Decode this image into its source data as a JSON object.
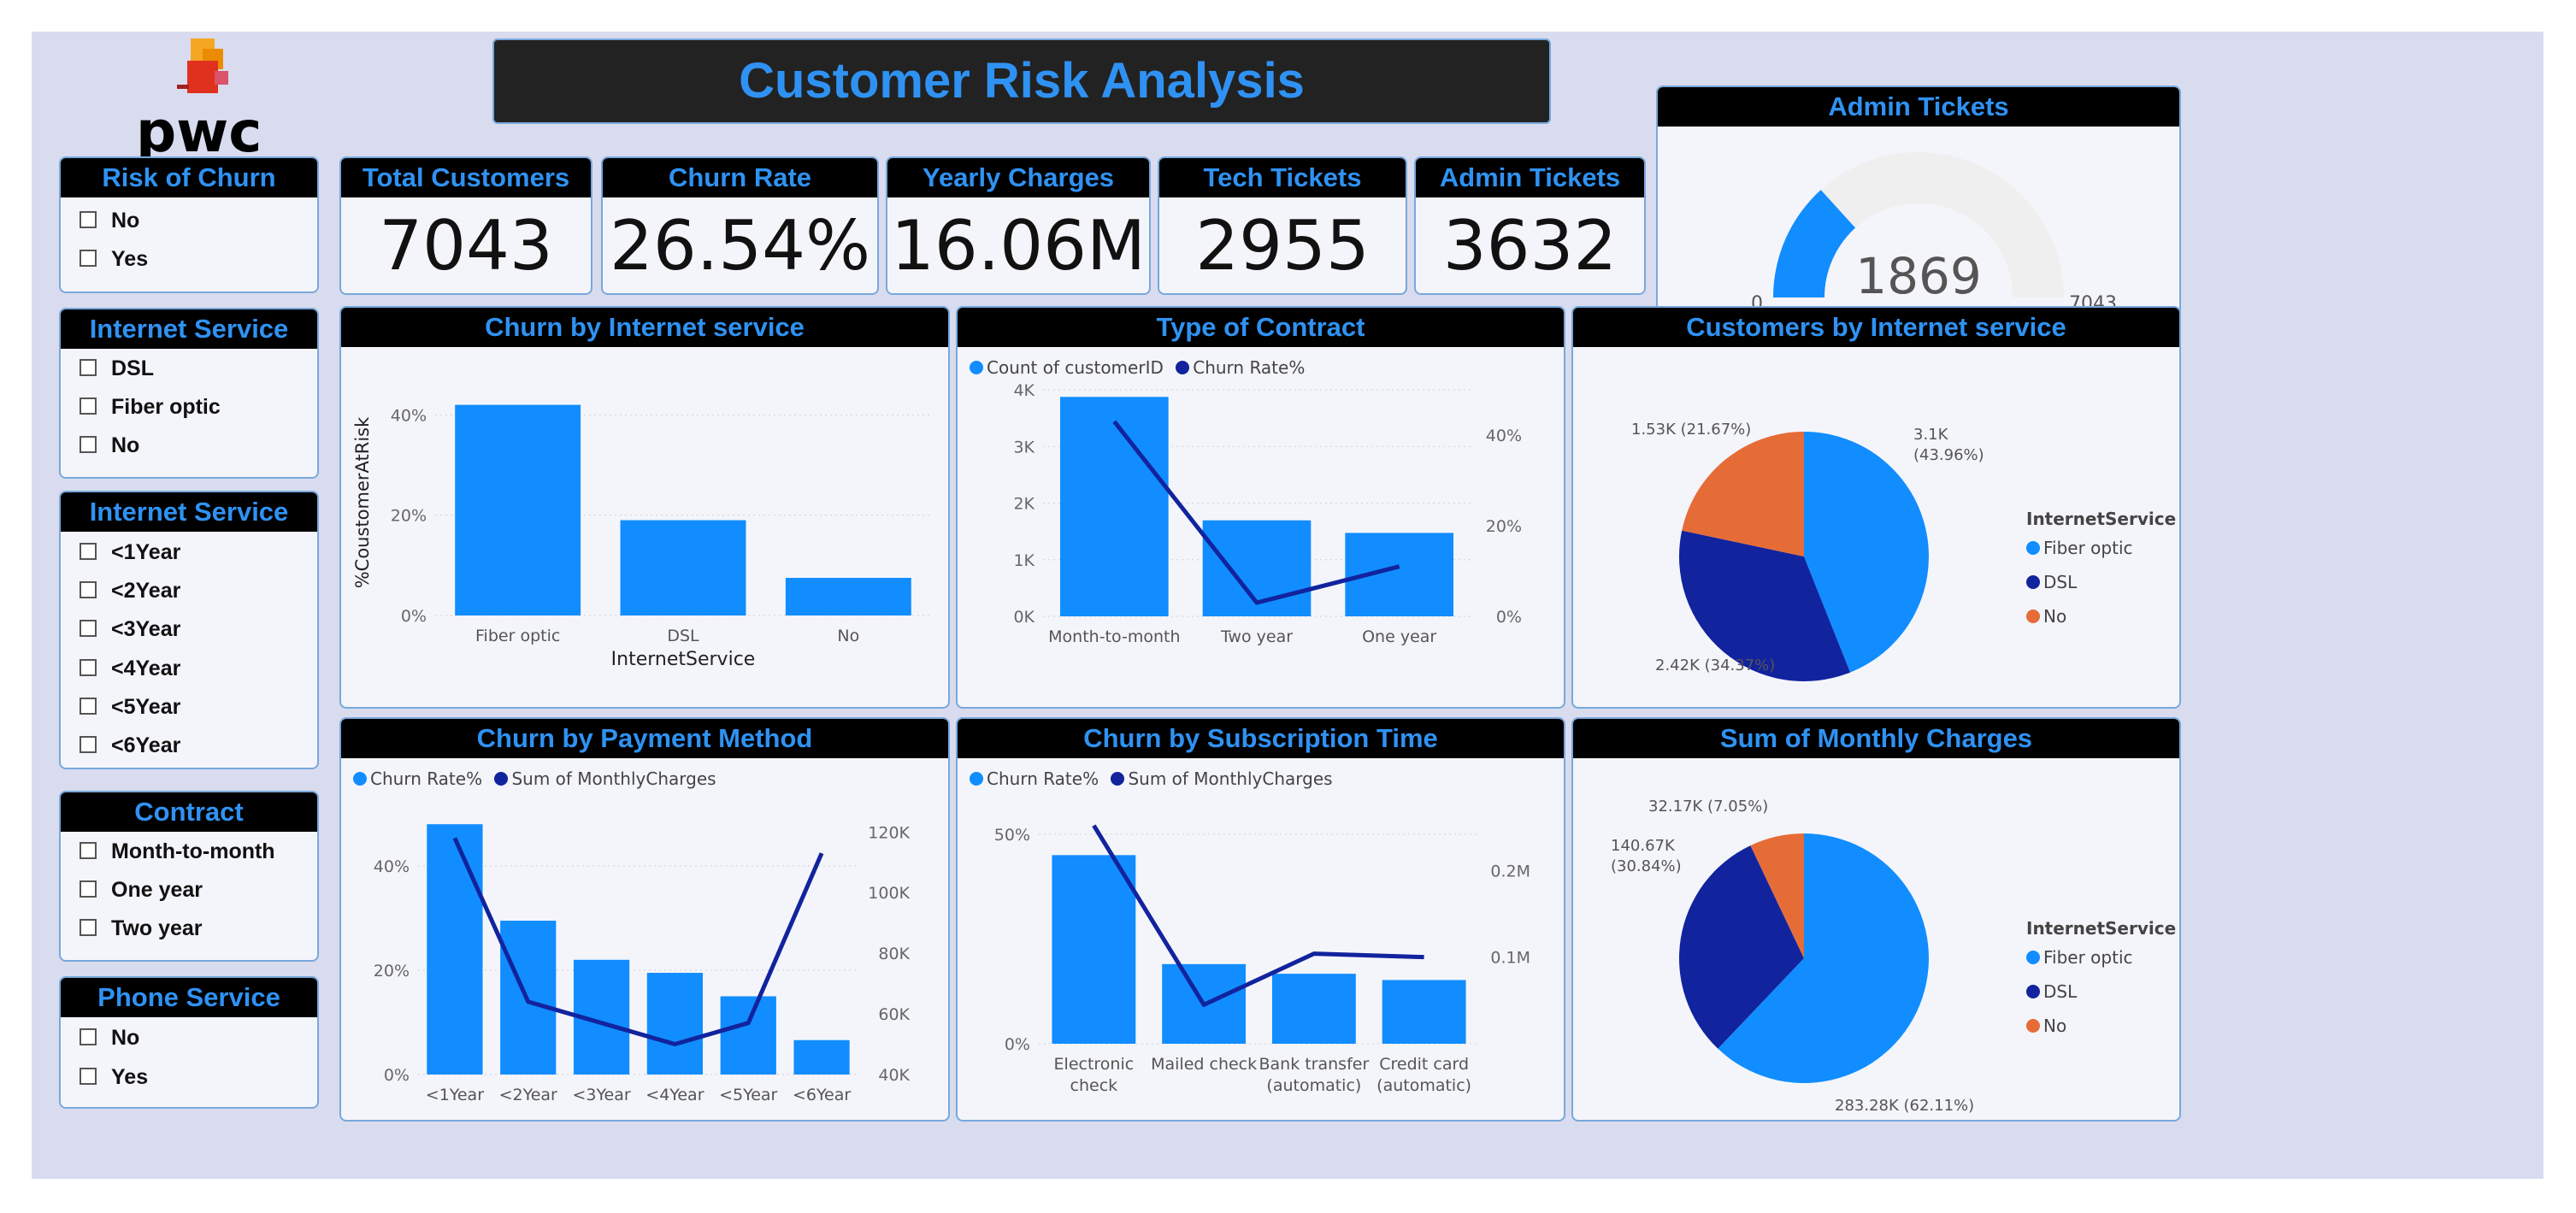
{
  "title": "Customer Risk Analysis",
  "logo": {
    "text": "pwc"
  },
  "colors": {
    "bar": "#118dff",
    "line": "#12239e",
    "orange": "#e66c37",
    "header_bg": "#000000",
    "header_text": "#2f92f3",
    "gauge_track": "#efefef"
  },
  "slicers": [
    {
      "title": "Risk of Churn",
      "items": [
        "No",
        "Yes"
      ]
    },
    {
      "title": "Internet Service",
      "items": [
        "DSL",
        "Fiber optic",
        "No"
      ]
    },
    {
      "title": "Internet Service",
      "items": [
        "<1Year",
        "<2Year",
        "<3Year",
        "<4Year",
        "<5Year",
        "<6Year"
      ]
    },
    {
      "title": "Contract",
      "items": [
        "Month-to-month",
        "One year",
        "Two year"
      ]
    },
    {
      "title": "Phone Service",
      "items": [
        "No",
        "Yes"
      ]
    }
  ],
  "kpis": [
    {
      "label": "Total Customers",
      "value": "7043"
    },
    {
      "label": "Churn Rate",
      "value": "26.54%"
    },
    {
      "label": "Yearly Charges",
      "value": "16.06M"
    },
    {
      "label": "Tech Tickets",
      "value": "2955"
    },
    {
      "label": "Admin Tickets",
      "value": "3632"
    }
  ],
  "gauge": {
    "title": "Admin Tickets",
    "value": 1869,
    "value_label": "1869",
    "min": 0,
    "min_label": "0",
    "max": 7043,
    "max_label": "7043"
  },
  "chart_data": [
    {
      "id": "churn_by_internet",
      "type": "bar",
      "title": "Churn by Internet service",
      "xlabel": "InternetService",
      "ylabel": "%CoustomerAtRisk",
      "categories": [
        "Fiber optic",
        "DSL",
        "No"
      ],
      "values": [
        42,
        19,
        7.5
      ],
      "ylim": [
        0,
        45
      ],
      "yticks": [
        {
          "v": 0,
          "label": "0%"
        },
        {
          "v": 20,
          "label": "20%"
        },
        {
          "v": 40,
          "label": "40%"
        }
      ]
    },
    {
      "id": "type_of_contract",
      "type": "bar",
      "title": "Type of Contract",
      "legend": [
        {
          "name": "Count of customerID",
          "color": "#118dff"
        },
        {
          "name": "Churn Rate%",
          "color": "#12239e"
        }
      ],
      "categories": [
        "Month-to-month",
        "Two year",
        "One year"
      ],
      "series": [
        {
          "name": "Count of customerID",
          "kind": "bar",
          "axis": "left",
          "values": [
            3875,
            1695,
            1473
          ]
        },
        {
          "name": "Churn Rate%",
          "kind": "line",
          "axis": "right",
          "values": [
            43,
            3,
            11
          ]
        }
      ],
      "ylim": [
        0,
        4000
      ],
      "y2lim": [
        0,
        50
      ],
      "yticks": [
        {
          "v": 0,
          "label": "0K"
        },
        {
          "v": 1000,
          "label": "1K"
        },
        {
          "v": 2000,
          "label": "2K"
        },
        {
          "v": 3000,
          "label": "3K"
        },
        {
          "v": 4000,
          "label": "4K"
        }
      ],
      "y2ticks": [
        {
          "v": 0,
          "label": "0%"
        },
        {
          "v": 20,
          "label": "20%"
        },
        {
          "v": 40,
          "label": "40%"
        }
      ]
    },
    {
      "id": "customers_by_internet",
      "type": "pie",
      "title": "Customers by Internet service",
      "legend_title": "InternetService",
      "slices": [
        {
          "name": "Fiber optic",
          "value": 3096,
          "label": "3.1K (43.96%)",
          "color": "#118dff"
        },
        {
          "name": "DSL",
          "value": 2421,
          "label": "2.42K (34.37%)",
          "color": "#12239e"
        },
        {
          "name": "No",
          "value": 1526,
          "label": "1.53K (21.67%)",
          "color": "#e66c37"
        }
      ]
    },
    {
      "id": "churn_by_payment",
      "type": "bar",
      "title": "Churn by Payment Method",
      "legend": [
        {
          "name": "Churn Rate%",
          "color": "#118dff"
        },
        {
          "name": "Sum of MonthlyCharges",
          "color": "#12239e"
        }
      ],
      "categories": [
        "<1Year",
        "<2Year",
        "<3Year",
        "<4Year",
        "<5Year",
        "<6Year"
      ],
      "series": [
        {
          "name": "Churn Rate%",
          "kind": "bar",
          "axis": "left",
          "values": [
            48,
            29.5,
            22,
            19.5,
            15,
            6.6
          ]
        },
        {
          "name": "Sum of MonthlyCharges",
          "kind": "line",
          "axis": "right",
          "values": [
            118000,
            64000,
            57000,
            50000,
            57000,
            113000
          ]
        }
      ],
      "ylim": [
        0,
        50
      ],
      "y2lim": [
        40000,
        126000
      ],
      "yticks": [
        {
          "v": 0,
          "label": "0%"
        },
        {
          "v": 20,
          "label": "20%"
        },
        {
          "v": 40,
          "label": "40%"
        }
      ],
      "y2ticks": [
        {
          "v": 40000,
          "label": "40K"
        },
        {
          "v": 60000,
          "label": "60K"
        },
        {
          "v": 80000,
          "label": "80K"
        },
        {
          "v": 100000,
          "label": "100K"
        },
        {
          "v": 120000,
          "label": "120K"
        }
      ]
    },
    {
      "id": "churn_by_subscription",
      "type": "bar",
      "title": "Churn by Subscription Time",
      "legend": [
        {
          "name": "Churn Rate%",
          "color": "#118dff"
        },
        {
          "name": "Sum of MonthlyCharges",
          "color": "#12239e"
        }
      ],
      "categories": [
        "Electronic check",
        "Mailed check",
        "Bank transfer (automatic)",
        "Credit card (automatic)"
      ],
      "series": [
        {
          "name": "Churn Rate%",
          "kind": "bar",
          "axis": "left",
          "values": [
            45,
            19,
            16.7,
            15.2
          ]
        },
        {
          "name": "Sum of MonthlyCharges",
          "kind": "line",
          "axis": "right",
          "values": [
            252000,
            45000,
            104000,
            100000
          ]
        }
      ],
      "ylim": [
        0,
        62
      ],
      "y2lim": [
        0,
        300000
      ],
      "yticks": [
        {
          "v": 0,
          "label": "0%"
        },
        {
          "v": 50,
          "label": "50%"
        }
      ],
      "y2ticks": [
        {
          "v": 100000,
          "label": "0.1M"
        },
        {
          "v": 200000,
          "label": "0.2M"
        }
      ]
    },
    {
      "id": "sum_monthly_charges",
      "type": "pie",
      "title": "Sum of Monthly Charges",
      "legend_title": "InternetService",
      "slices": [
        {
          "name": "Fiber optic",
          "value": 283280,
          "label": "283.28K (62.11%)",
          "color": "#118dff"
        },
        {
          "name": "DSL",
          "value": 140670,
          "label": "140.67K (30.84%)",
          "color": "#12239e"
        },
        {
          "name": "No",
          "value": 32170,
          "label": "32.17K (7.05%)",
          "color": "#e66c37"
        }
      ]
    }
  ]
}
